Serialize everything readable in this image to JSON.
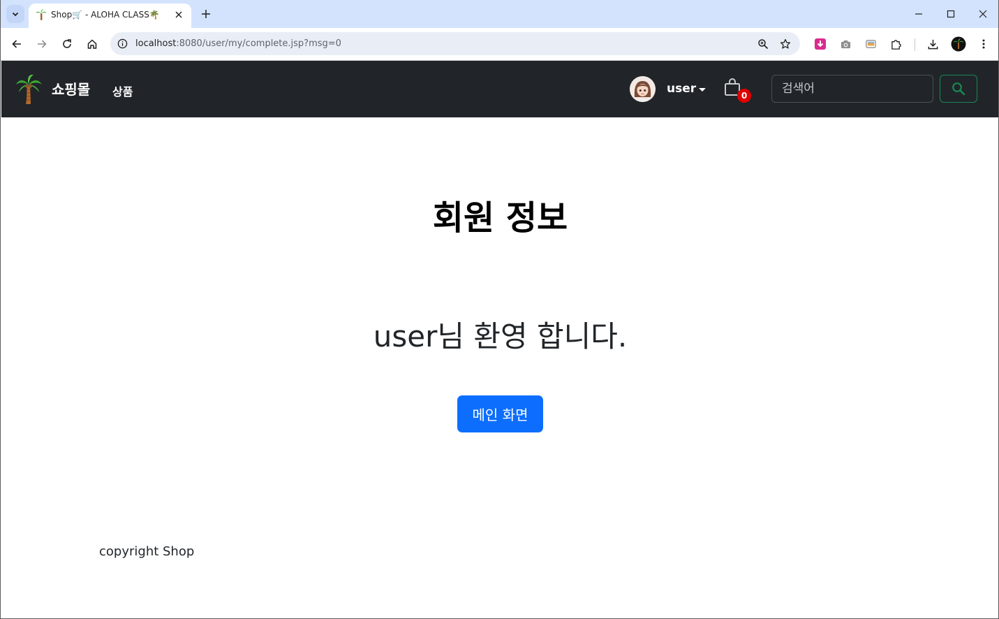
{
  "browser": {
    "tab_title": "Shop🛒 - ALOHA CLASS🌴",
    "url_host": "localhost",
    "url_path": ":8080/user/my/complete.jsp?msg=0"
  },
  "navbar": {
    "brand": "쇼핑몰",
    "nav_link": "상품",
    "username": "user",
    "cart_count": "0",
    "search_placeholder": "검색어"
  },
  "main": {
    "title": "회원 정보",
    "welcome": "user님 환영 합니다.",
    "main_button": "메인 화면"
  },
  "footer": {
    "text": "copyright Shop"
  },
  "colors": {
    "navbar_bg": "#212529",
    "primary": "#0d6efd",
    "success": "#198754",
    "badge": "#e00000"
  }
}
